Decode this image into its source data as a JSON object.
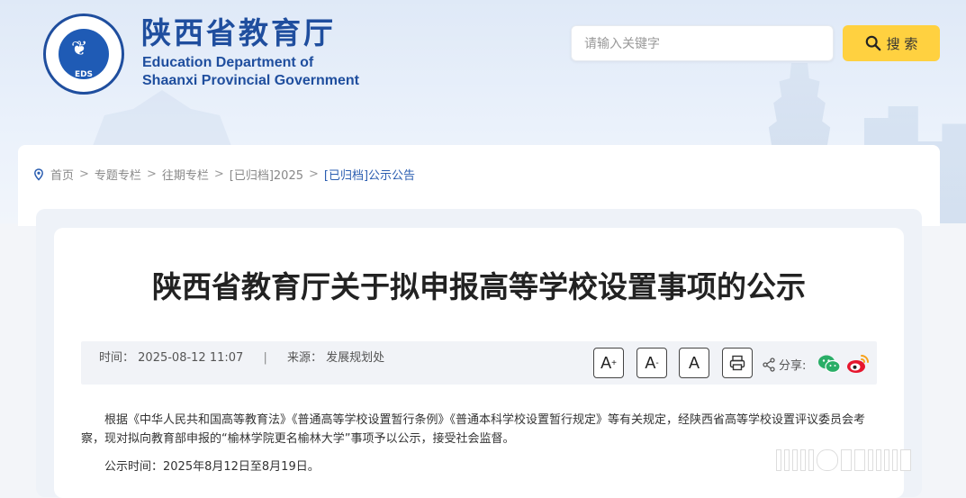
{
  "header": {
    "logo_cn": "陕西省教育厅",
    "logo_en_line1": "Education Department of",
    "logo_en_line2": "Shaanxi Provincial Government",
    "emblem_text": "EDS",
    "search": {
      "placeholder": "请输入关键字",
      "button_label": "搜 索",
      "button_color": "#ffd140"
    }
  },
  "breadcrumb": {
    "items": [
      "首页",
      "专题专栏",
      "往期专栏",
      "[已归档]2025",
      "[已归档]公示公告"
    ],
    "separator": ">"
  },
  "article": {
    "title": "陕西省教育厅关于拟申报高等学校设置事项的公示",
    "time_label": "时间：",
    "time_value": "2025-08-12 11:07",
    "meta_divider": "|",
    "source_label": "来源：",
    "source_value": "发展规划处",
    "font_buttons": {
      "increase": "A",
      "decrease": "A",
      "reset": "A"
    },
    "share_label": "分享:",
    "paragraphs": [
      "根据《中华人民共和国高等教育法》《普通高等学校设置暂行条例》《普通本科学校设置暂行规定》等有关规定，经陕西省高等学校设置评议委员会考察，现对拟向教育部申报的“榆林学院更名榆林大学”事项予以公示，接受社会监督。",
      "公示时间：2025年8月12日至8月19日。"
    ]
  },
  "colors": {
    "brand_blue": "#1f4e9e",
    "link_blue": "#2a5db0",
    "wechat_green": "#2aae67",
    "weibo_red": "#e6162d"
  }
}
